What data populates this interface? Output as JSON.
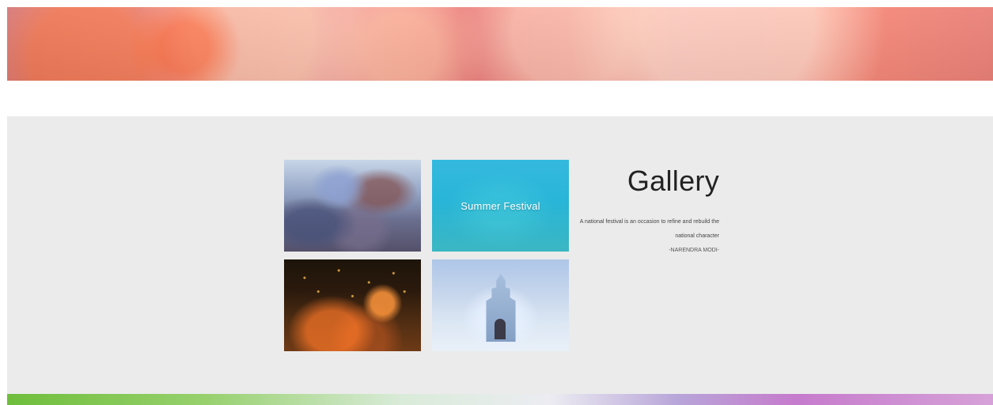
{
  "gallery": {
    "title": "Gallery",
    "quote": "A national festival is an occasion to refine and rebuild the national character",
    "author": "-NARENDRA MODI-",
    "tiles": [
      {
        "caption": ""
      },
      {
        "caption": "Summer Festival"
      },
      {
        "caption": ""
      },
      {
        "caption": ""
      }
    ]
  },
  "colors": {
    "band_background": "#ebebeb",
    "highlight_tile": "#30b6db",
    "text_primary": "#222222"
  },
  "icons": {
    "hero": "festival-banner-image",
    "tile_1": "festival-street-photo",
    "tile_3": "lanterns-night-photo",
    "tile_4": "ice-castle-photo"
  }
}
